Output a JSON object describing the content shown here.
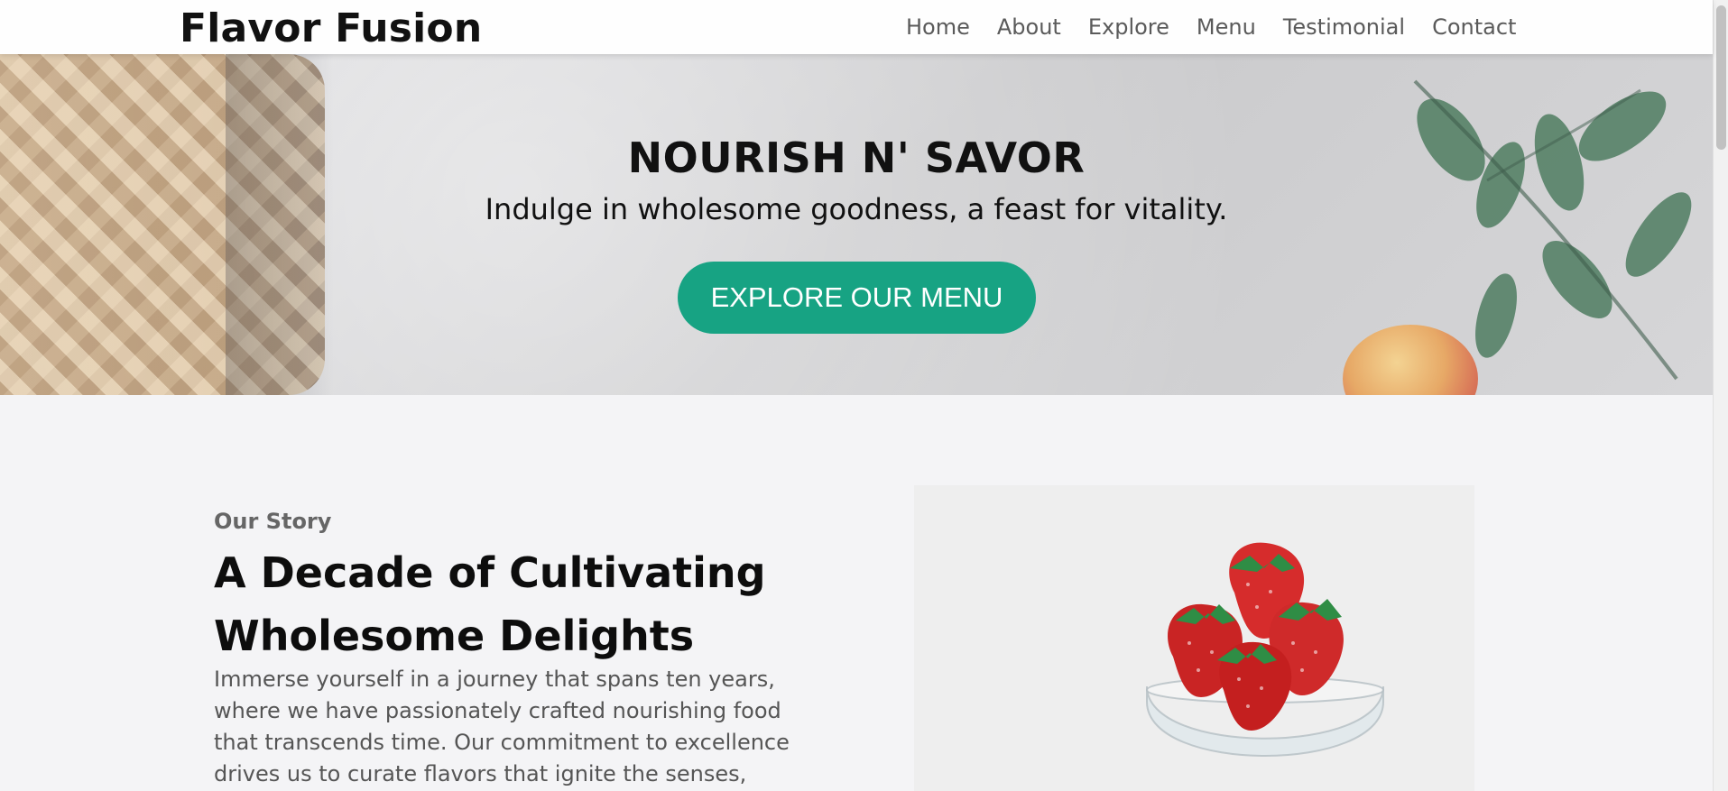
{
  "header": {
    "brand": "Flavor Fusion",
    "nav": [
      "Home",
      "About",
      "Explore",
      "Menu",
      "Testimonial",
      "Contact"
    ]
  },
  "hero": {
    "title": "NOURISH N' SAVOR",
    "subtitle": "Indulge in wholesome goodness, a feast for vitality.",
    "cta": "EXPLORE OUR MENU"
  },
  "story": {
    "eyebrow": "Our Story",
    "heading": "A Decade of Cultivating Wholesome Delights",
    "text": "Immerse yourself in a journey that spans ten years, where we have passionately crafted nourishing food that transcends time. Our commitment to excellence drives us to curate flavors that ignite the senses,"
  },
  "colors": {
    "accent": "#17a383",
    "nav_text": "#5a5a5a",
    "heading_text": "#111111",
    "body_text": "#555555"
  },
  "icons": {
    "hero_left_image": "pie-image",
    "hero_right_image": "leaves-apple-image",
    "story_image": "strawberries-image"
  }
}
